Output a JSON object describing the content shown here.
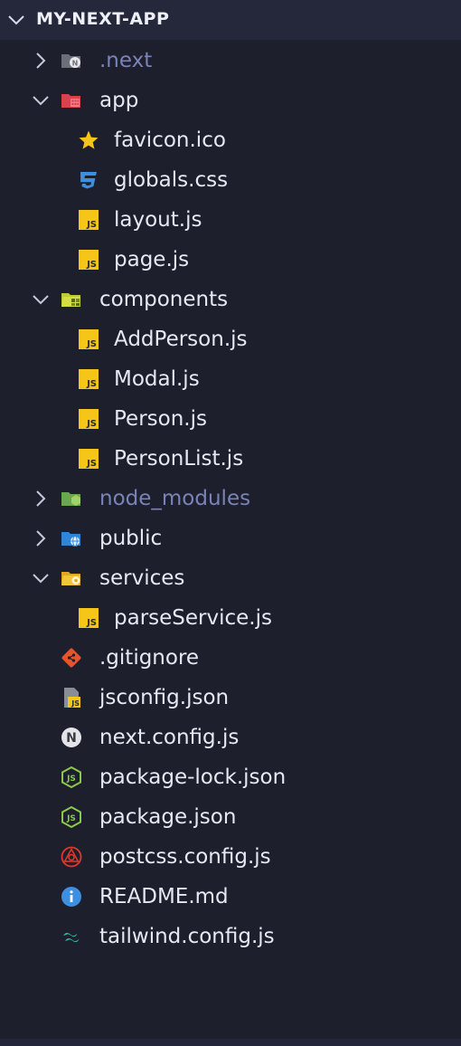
{
  "explorer": {
    "root_label": "MY-NEXT-APP",
    "items": [
      {
        "label": ".next",
        "kind": "folder",
        "state": "collapsed",
        "icon": "next-folder-icon",
        "dim": true
      },
      {
        "label": "app",
        "kind": "folder",
        "state": "expanded",
        "icon": "app-folder-icon"
      },
      {
        "label": "favicon.ico",
        "kind": "file",
        "icon": "star-icon"
      },
      {
        "label": "globals.css",
        "kind": "file",
        "icon": "css-icon"
      },
      {
        "label": "layout.js",
        "kind": "file",
        "icon": "js-icon"
      },
      {
        "label": "page.js",
        "kind": "file",
        "icon": "js-icon"
      },
      {
        "label": "components",
        "kind": "folder",
        "state": "expanded",
        "icon": "components-folder-icon"
      },
      {
        "label": "AddPerson.js",
        "kind": "file",
        "icon": "js-icon"
      },
      {
        "label": "Modal.js",
        "kind": "file",
        "icon": "js-icon"
      },
      {
        "label": "Person.js",
        "kind": "file",
        "icon": "js-icon"
      },
      {
        "label": "PersonList.js",
        "kind": "file",
        "icon": "js-icon"
      },
      {
        "label": "node_modules",
        "kind": "folder",
        "state": "collapsed",
        "icon": "node-folder-icon",
        "dim": true
      },
      {
        "label": "public",
        "kind": "folder",
        "state": "collapsed",
        "icon": "public-folder-icon"
      },
      {
        "label": "services",
        "kind": "folder",
        "state": "expanded",
        "icon": "services-folder-icon"
      },
      {
        "label": "parseService.js",
        "kind": "file",
        "icon": "js-icon"
      },
      {
        "label": ".gitignore",
        "kind": "file",
        "icon": "git-icon"
      },
      {
        "label": "jsconfig.json",
        "kind": "file",
        "icon": "jsconfig-icon"
      },
      {
        "label": "next.config.js",
        "kind": "file",
        "icon": "next-icon"
      },
      {
        "label": "package-lock.json",
        "kind": "file",
        "icon": "nodejs-icon"
      },
      {
        "label": "package.json",
        "kind": "file",
        "icon": "nodejs-icon"
      },
      {
        "label": "postcss.config.js",
        "kind": "file",
        "icon": "postcss-icon"
      },
      {
        "label": "README.md",
        "kind": "file",
        "icon": "info-icon"
      },
      {
        "label": "tailwind.config.js",
        "kind": "file",
        "icon": "tailwind-icon"
      }
    ]
  },
  "colors": {
    "background": "#1e1f2c",
    "header_background": "#24283a",
    "text": "#e6e8f2",
    "dim_text": "#7a83b8",
    "js_yellow": "#f5c518",
    "css_blue": "#3d8fe0",
    "node_green": "#8cc84b"
  }
}
